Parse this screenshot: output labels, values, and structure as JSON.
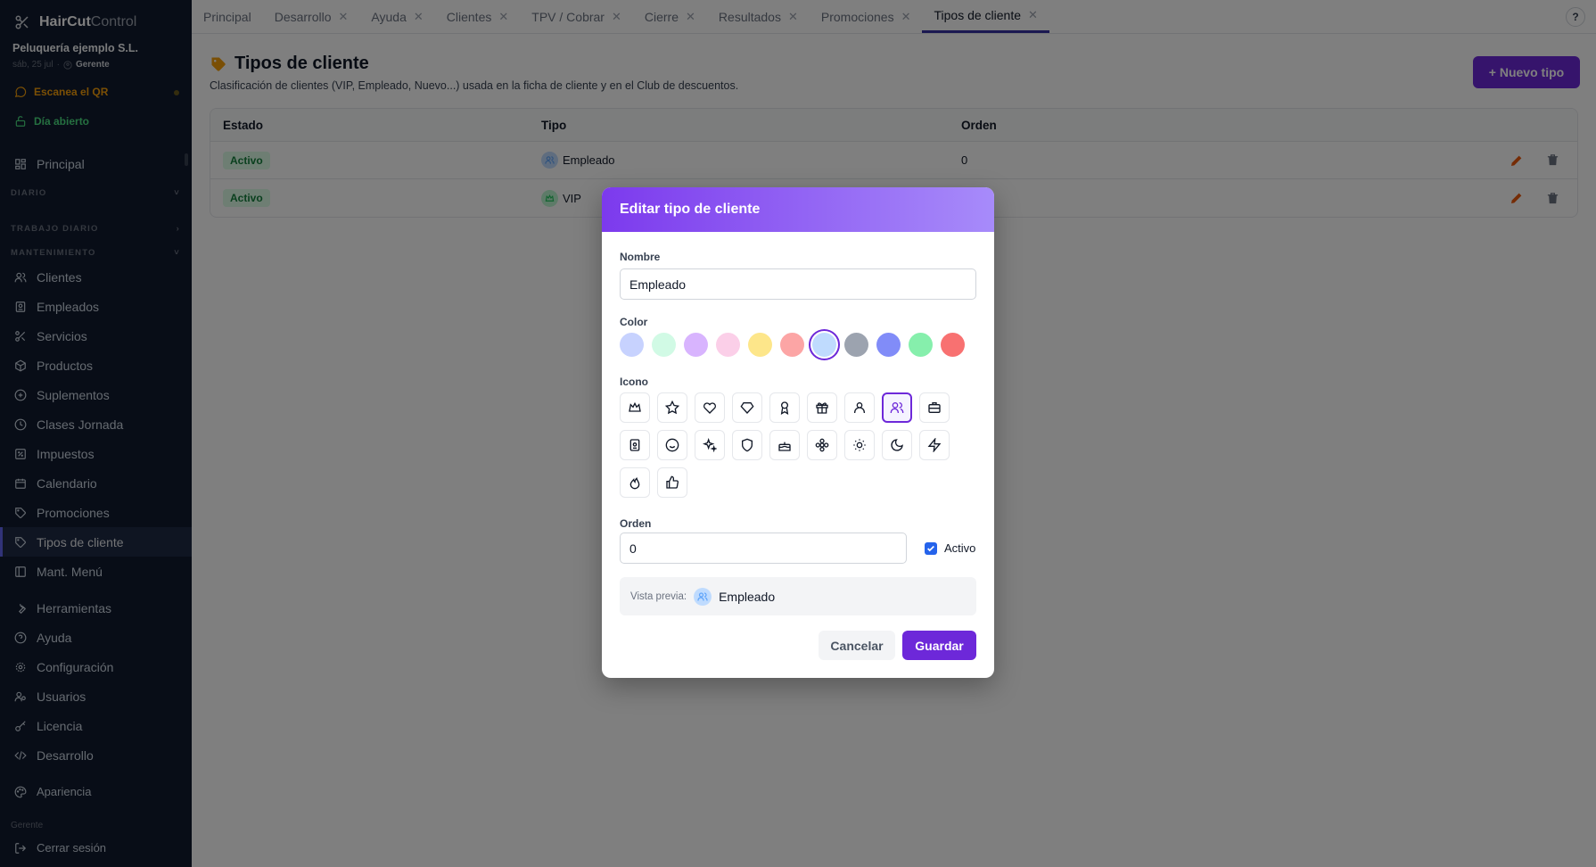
{
  "app": {
    "brand_bold": "HairCut",
    "brand_light": "Control",
    "company": "Peluquería ejemplo S.L.",
    "date": "sáb, 25 jul",
    "role": "Gerente"
  },
  "sidebar": {
    "qr": "Escanea el QR",
    "day_open": "Día abierto",
    "principal": "Principal",
    "sections": [
      "DIARIO",
      "TRABAJO DIARIO",
      "MANTENIMIENTO"
    ],
    "items": [
      "Clientes",
      "Empleados",
      "Servicios",
      "Productos",
      "Suplementos",
      "Clases Jornada",
      "Impuestos",
      "Calendario",
      "Promociones",
      "Tipos de cliente",
      "Mant. Menú"
    ],
    "tools": [
      "Herramientas",
      "Ayuda",
      "Configuración",
      "Usuarios",
      "Licencia",
      "Desarrollo"
    ],
    "appearance": "Apariencia",
    "footer_role": "Gerente",
    "logout": "Cerrar sesión"
  },
  "tabs": [
    {
      "label": "Principal",
      "closable": false
    },
    {
      "label": "Desarrollo",
      "closable": true
    },
    {
      "label": "Ayuda",
      "closable": true
    },
    {
      "label": "Clientes",
      "closable": true
    },
    {
      "label": "TPV / Cobrar",
      "closable": true
    },
    {
      "label": "Cierre",
      "closable": true
    },
    {
      "label": "Resultados",
      "closable": true
    },
    {
      "label": "Promociones",
      "closable": true
    },
    {
      "label": "Tipos de cliente",
      "closable": true,
      "active": true
    }
  ],
  "help_label": "?",
  "page": {
    "title": "Tipos de cliente",
    "description": "Clasificación de clientes (VIP, Empleado, Nuevo...) usada en la ficha de cliente y en el Club de descuentos.",
    "new_button": "+ Nuevo tipo"
  },
  "table": {
    "headers": [
      "Estado",
      "Tipo",
      "Orden"
    ],
    "rows": [
      {
        "estado": "Activo",
        "tipo": "Empleado",
        "orden": "0",
        "color": "#bfdbfe"
      },
      {
        "estado": "Activo",
        "tipo": "VIP",
        "orden": "",
        "color": "#bbf7d0"
      }
    ]
  },
  "modal": {
    "title": "Editar tipo de cliente",
    "name_label": "Nombre",
    "name_value": "Empleado",
    "color_label": "Color",
    "colors": [
      "#c7d2fe",
      "#d1fae5",
      "#d8b4fe",
      "#fbcfe8",
      "#fde68a",
      "#fca5a5",
      "#bfdbfe",
      "#9ca3af",
      "#818cf8",
      "#86efac",
      "#f87171"
    ],
    "selected_color": 6,
    "icon_label": "Icono",
    "icons": [
      "crown-icon",
      "star-icon",
      "heart-icon",
      "diamond-icon",
      "award-icon",
      "gift-icon",
      "user-icon",
      "users-icon",
      "briefcase-icon",
      "badge-icon",
      "smile-icon",
      "sparkles-icon",
      "shield-icon",
      "cake-icon",
      "flower-icon",
      "sun-icon",
      "moon-icon",
      "zap-icon",
      "flame-icon",
      "thumbs-up-icon"
    ],
    "selected_icon": 7,
    "order_label": "Orden",
    "order_value": "0",
    "active_label": "Activo",
    "active_checked": true,
    "preview_label": "Vista previa:",
    "preview_name": "Empleado",
    "cancel": "Cancelar",
    "save": "Guardar"
  }
}
